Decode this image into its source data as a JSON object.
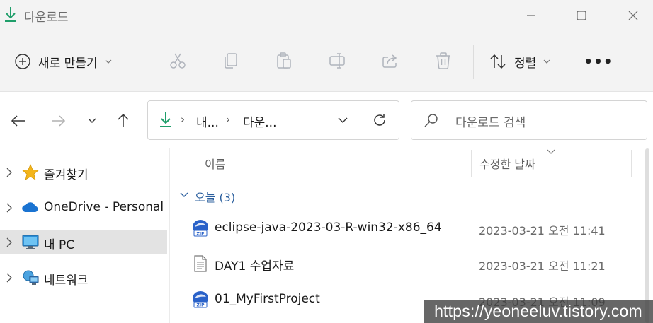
{
  "window": {
    "title": "다운로드"
  },
  "toolbar": {
    "new_label": "새로 만들기",
    "sort_label": "정렬",
    "more_label": "•••"
  },
  "address": {
    "crumb1": "내...",
    "crumb2": "다운...",
    "sep": "›"
  },
  "search": {
    "placeholder": "다운로드 검색"
  },
  "sidebar": {
    "items": [
      {
        "label": "즐겨찾기",
        "icon": "star-icon"
      },
      {
        "label": "OneDrive - Personal",
        "icon": "cloud-icon"
      },
      {
        "label": "내 PC",
        "icon": "pc-icon"
      },
      {
        "label": "네트워크",
        "icon": "network-icon"
      }
    ],
    "selected_index": 2
  },
  "content": {
    "columns": {
      "name": "이름",
      "date": "수정한 날짜"
    },
    "group_label": "오늘 (3)",
    "files": [
      {
        "name": "eclipse-java-2023-03-R-win32-x86_64",
        "date": "2023-03-21 오전 11:41",
        "icon": "zip-icon"
      },
      {
        "name": "DAY1 수업자료",
        "date": "2023-03-21 오전 11:21",
        "icon": "text-file-icon"
      },
      {
        "name": "01_MyFirstProject",
        "date": "2023-03-21 오전 11:09",
        "icon": "zip-icon"
      }
    ]
  },
  "watermark": "https://yeoneeluv.tistory.com",
  "colors": {
    "accent_download": "#1f9e6a",
    "group_label": "#2b5f9e",
    "star": "#f3b51b",
    "cloud": "#1a73d1"
  }
}
